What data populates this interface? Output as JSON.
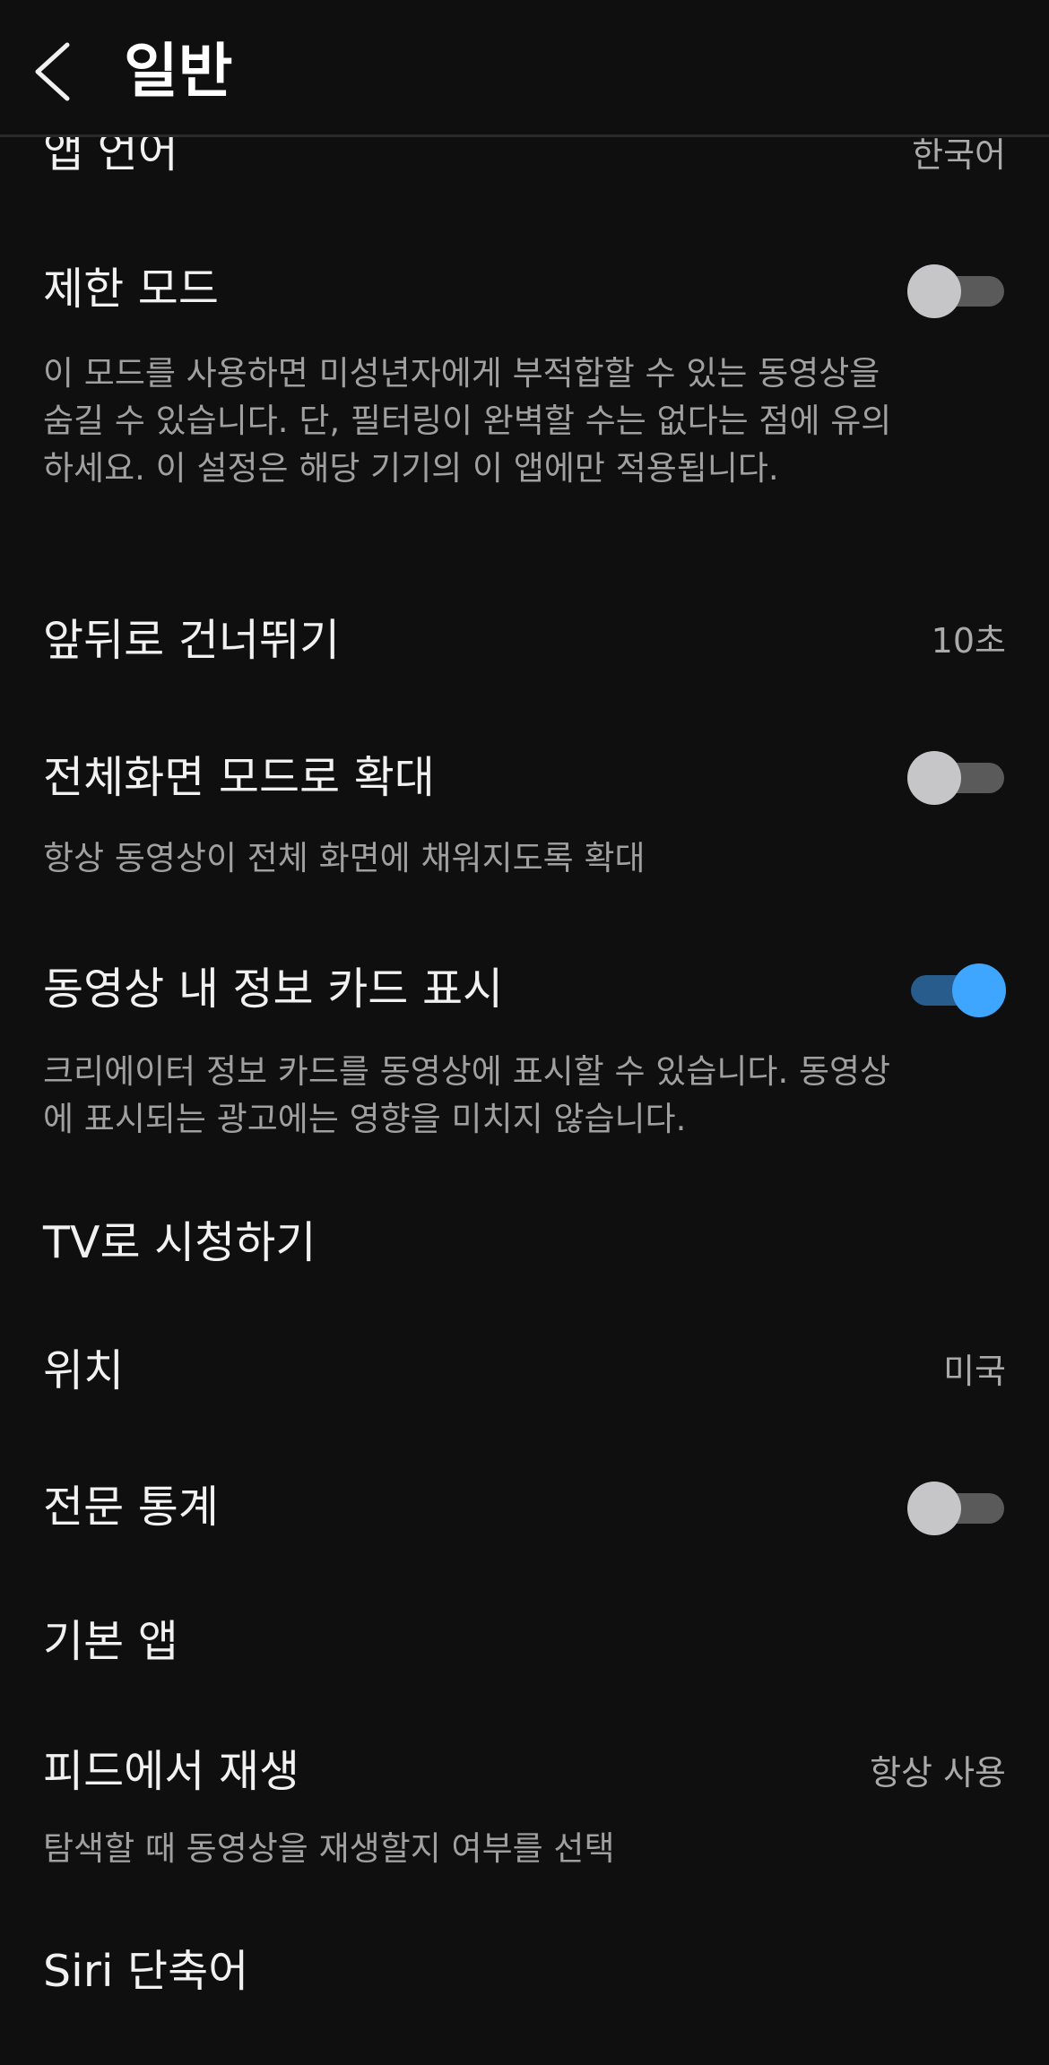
{
  "header": {
    "title": "일반",
    "back_icon": "chevron-left-icon"
  },
  "settings": [
    {
      "title": "앱 언어",
      "value": "한국어"
    },
    {
      "title": "제한 모드",
      "toggle": false,
      "description": "이 모드를 사용하면 미성년자에게 부적합할 수 있는 동영상을 숨길 수 있습니다. 단, 필터링이 완벽할 수는 없다는 점에 유의하세요. 이 설정은 해당 기기의 이 앱에만 적용됩니다."
    },
    {
      "title": "앞뒤로 건너뛰기",
      "value": "10초"
    },
    {
      "title": "전체화면 모드로 확대",
      "toggle": false,
      "description": "항상 동영상이 전체 화면에 채워지도록 확대"
    },
    {
      "title": "동영상 내 정보 카드 표시",
      "toggle": true,
      "description": "크리에이터 정보 카드를 동영상에 표시할 수 있습니다. 동영상에 표시되는 광고에는 영향을 미치지 않습니다."
    },
    {
      "title": "TV로 시청하기"
    },
    {
      "title": "위치",
      "value": "미국"
    },
    {
      "title": "전문 통계",
      "toggle": false
    },
    {
      "title": "기본 앱"
    },
    {
      "title": "피드에서 재생",
      "value": "항상 사용",
      "description": "탐색할 때 동영상을 재생할지 여부를 선택"
    },
    {
      "title": "Siri 단축어"
    }
  ],
  "colors": {
    "background": "#0f0f0f",
    "toggle_on": "#3ea6ff",
    "toggle_on_track": "#275c8c",
    "toggle_off_knob": "#c6c6c8",
    "toggle_off_track": "#5a5a5a"
  }
}
